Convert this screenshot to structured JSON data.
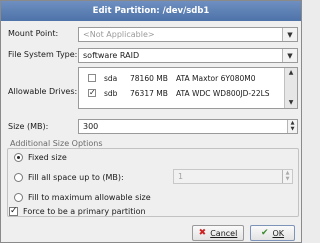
{
  "window": {
    "title": "Edit Partition: /dev/sdb1"
  },
  "mount_point": {
    "label": "Mount Point:",
    "value": "<Not Applicable>"
  },
  "fs_type": {
    "label": "File System Type:",
    "value": "software RAID"
  },
  "drives": {
    "label": "Allowable Drives:",
    "rows": [
      {
        "name": "sda",
        "size": "78160 MB",
        "model": "ATA Maxtor 6Y080M0",
        "checked": false
      },
      {
        "name": "sdb",
        "size": "76317 MB",
        "model": "ATA WDC WD800JD-22LS",
        "checked": true
      }
    ]
  },
  "size": {
    "label": "Size (MB):",
    "value": "300"
  },
  "options": {
    "title": "Additional Size Options",
    "fixed": "Fixed size",
    "fill_upto": "Fill all space up to (MB):",
    "fill_upto_value": "1",
    "fill_max": "Fill to maximum allowable size",
    "selected": "fixed"
  },
  "primary": {
    "label": "Force to be a primary partition",
    "checked": true
  },
  "buttons": {
    "cancel": "Cancel",
    "ok": "OK"
  },
  "colors": {
    "title_bar": "#5679b0",
    "cancel_icon": "#cc2222",
    "ok_icon": "#3a8a2a"
  }
}
